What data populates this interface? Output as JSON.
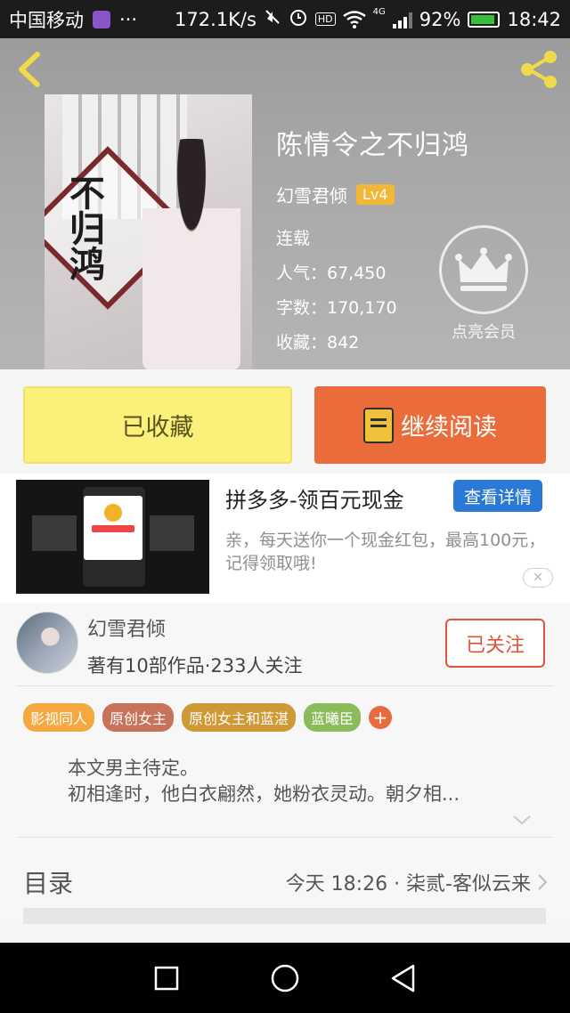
{
  "status_bar": {
    "carrier": "中国移动",
    "more": "···",
    "net_speed": "172.1K/s",
    "hd": "HD",
    "network": "4G",
    "battery": "92%",
    "battery_level": 0.92,
    "time": "18:42"
  },
  "book": {
    "title": "陈情令之不归鸿",
    "author": "幻雪君倾",
    "level": "Lv4",
    "status": "连载",
    "popularity": "人气：67,450",
    "word_count": "字数：170,170",
    "favorites": "收藏：842",
    "cover_title_art": "不归鸿"
  },
  "vip": {
    "label": "点亮会员"
  },
  "actions": {
    "favorite_label": "已收藏",
    "read_label": "继续阅读"
  },
  "ad": {
    "title": "拼多多-领百元现金",
    "detail_label": "查看详情",
    "description": "亲，每天送你一个现金红包，最高100元，记得领取哦!",
    "close_symbol": "✕"
  },
  "author": {
    "name": "幻雪君倾",
    "stats": "著有10部作品·233人关注",
    "follow_label": "已关注"
  },
  "tags": [
    {
      "label": "影视同人",
      "color": "#f3a940"
    },
    {
      "label": "原创女主",
      "color": "#c9725a"
    },
    {
      "label": "原创女主和蓝湛",
      "color": "#cf9a35"
    },
    {
      "label": "蓝曦臣",
      "color": "#8cbc5a"
    }
  ],
  "tag_add": "+",
  "synopsis": {
    "line1": "本文男主待定。",
    "line2": "初相逢时，他白衣翩然，她粉衣灵动。朝夕相..."
  },
  "toc": {
    "title": "目录",
    "latest": "今天 18:26 · 柒贰-客似云来"
  }
}
